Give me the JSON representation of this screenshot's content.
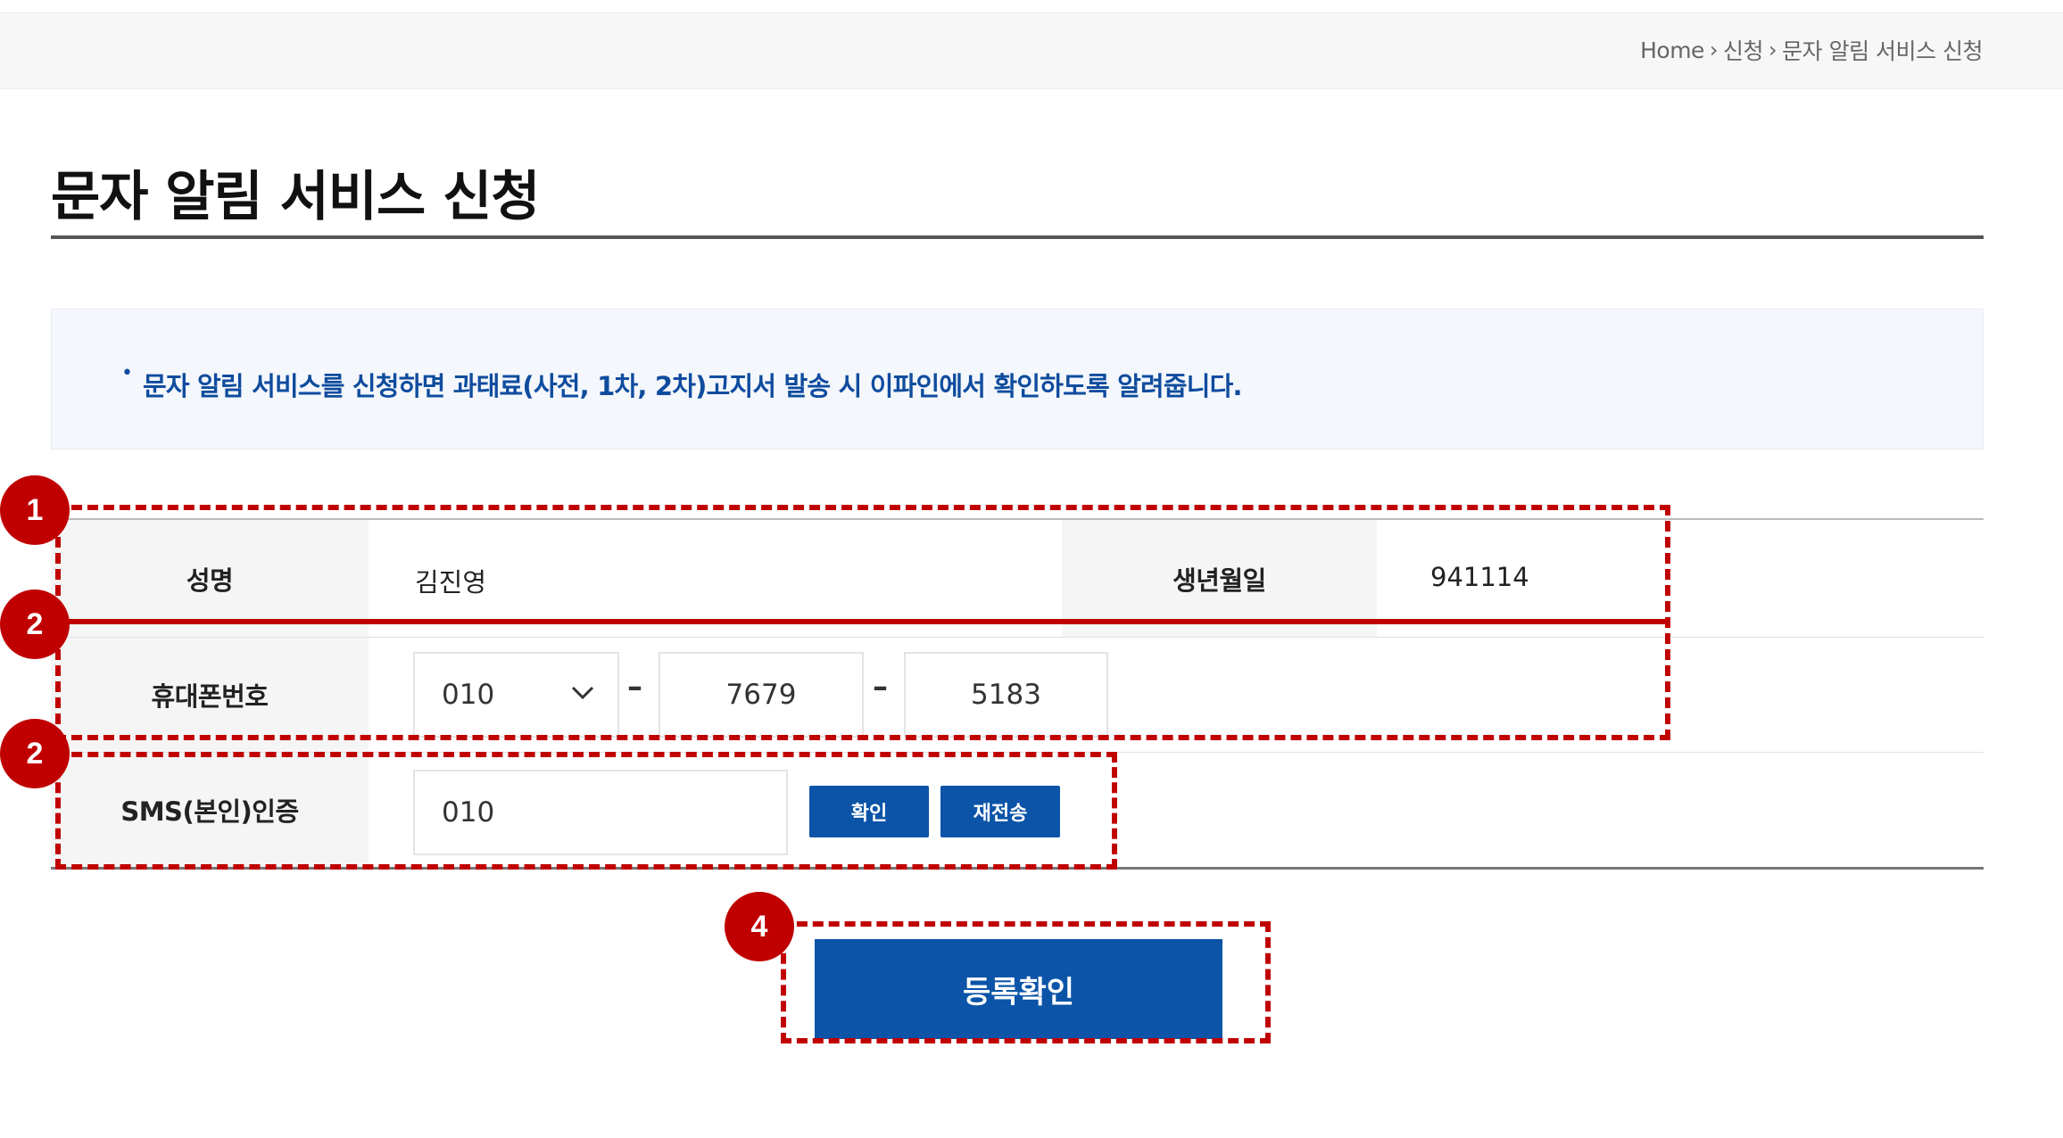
{
  "breadcrumb": {
    "home": "Home",
    "level1": "신청",
    "level2": "문자 알림 서비스 신청"
  },
  "page_title": "문자 알림 서비스 신청",
  "notice": {
    "text": "문자 알림 서비스를 신청하면 과태료(사전, 1차, 2차)고지서 발송 시 이파인에서 확인하도록 알려줍니다."
  },
  "form": {
    "name_label": "성명",
    "name_value": "김진영",
    "birth_label": "생년월일",
    "birth_value": "941114",
    "phone_label": "휴대폰번호",
    "phone_prefix": "010",
    "phone_middle": "7679",
    "phone_last": "5183",
    "sms_label": "SMS(본인)인증",
    "sms_value": "010",
    "confirm_label": "확인",
    "resend_label": "재전송"
  },
  "submit_label": "등록확인",
  "annotations": {
    "badge1": "1",
    "badge2a": "2",
    "badge2b": "2",
    "badge4": "4",
    "color": "#c00000"
  },
  "accent_color": "#0b54a8"
}
